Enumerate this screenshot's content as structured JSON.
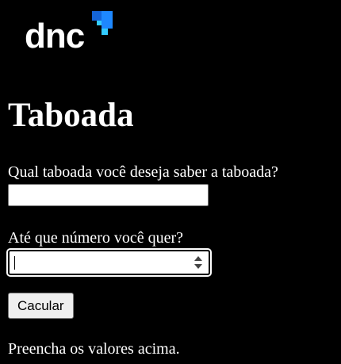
{
  "header": {
    "logo_text": "dnc",
    "logo_icon": "dnc-logo-squares-icon",
    "logo_accent_colors": [
      "#1565d8",
      "#1e88ff",
      "#33ccff"
    ]
  },
  "main": {
    "title": "Taboada",
    "question_label": "Qual taboada você deseja saber a taboada?",
    "question_value": "",
    "limit_label": "Até que número você quer?",
    "limit_value": "",
    "calculate_button_label": "Cacular",
    "result_text": "Preencha os valores acima."
  },
  "colors": {
    "background": "#000000",
    "text": "#ffffff",
    "input_background": "#ffffff",
    "button_background": "#efefef"
  }
}
